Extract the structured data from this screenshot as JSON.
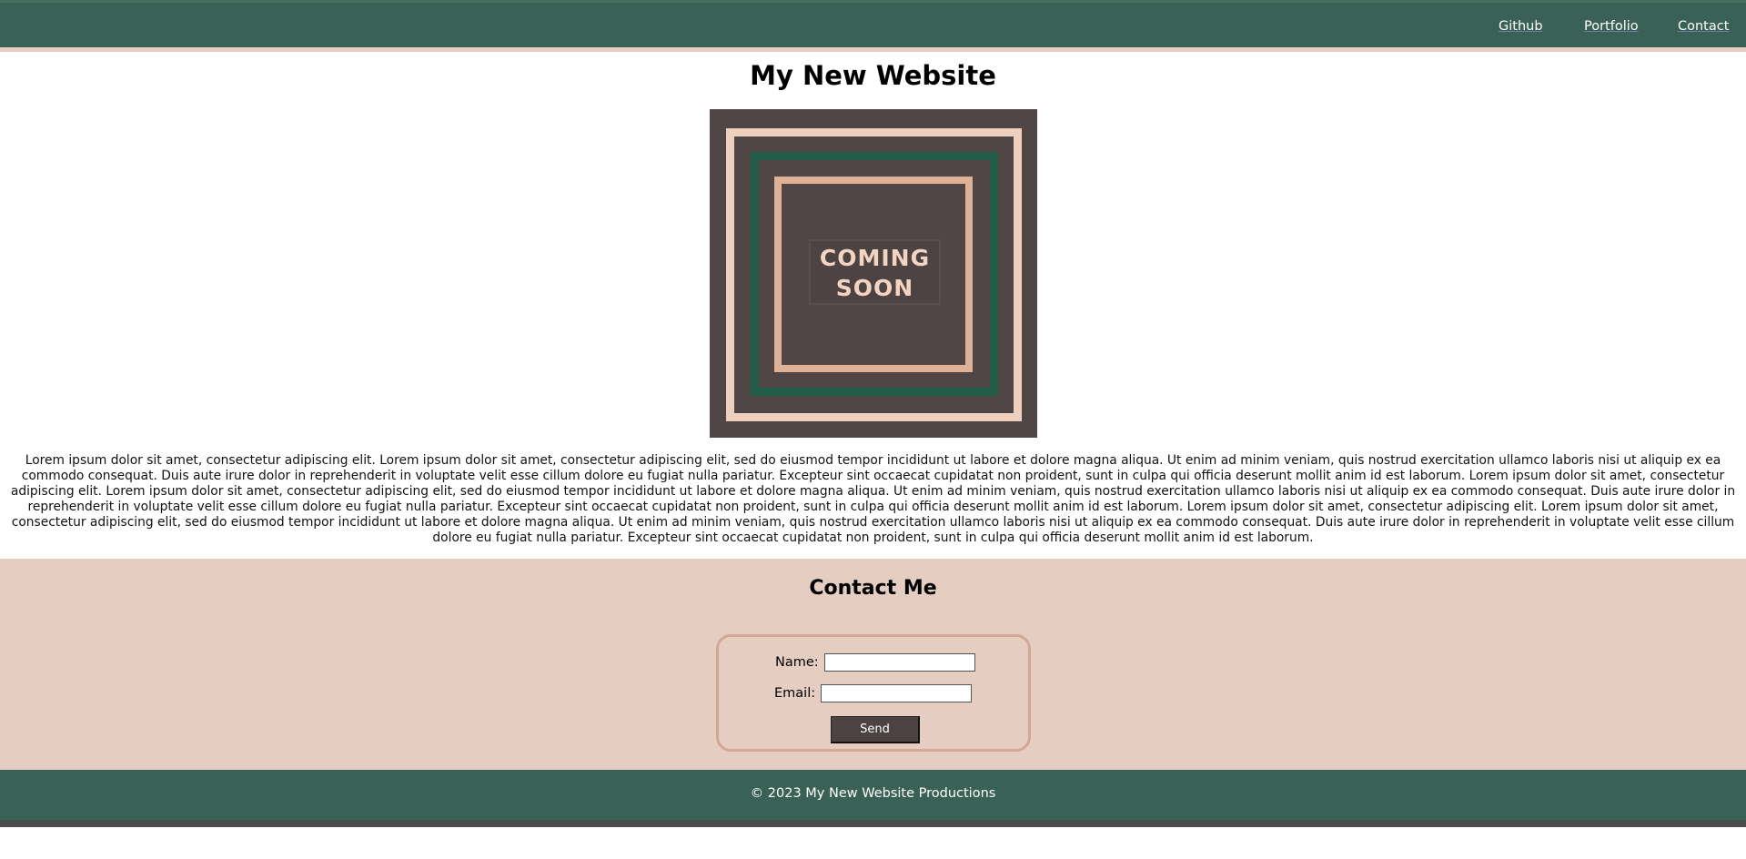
{
  "nav": {
    "links": [
      "Github",
      "Portfolio",
      "Contact"
    ]
  },
  "header": {
    "title": "My New Website"
  },
  "hero": {
    "image_text": "COMING SOON",
    "colors": {
      "background": "#504645",
      "outer_square": "#efcfbe",
      "middle_square": "#215c48",
      "inner_square": "#dfb195"
    }
  },
  "intro": {
    "text": "Lorem ipsum dolor sit amet, consectetur adipiscing elit. Lorem ipsum dolor sit amet, consectetur adipiscing elit, sed do eiusmod tempor incididunt ut labore et dolore magna aliqua. Ut enim ad minim veniam, quis nostrud exercitation ullamco laboris nisi ut aliquip ex ea commodo consequat. Duis aute irure dolor in reprehenderit in voluptate velit esse cillum dolore eu fugiat nulla pariatur. Excepteur sint occaecat cupidatat non proident, sunt in culpa qui officia deserunt mollit anim id est laborum. Lorem ipsum dolor sit amet, consectetur adipiscing elit. Lorem ipsum dolor sit amet, consectetur adipiscing elit, sed do eiusmod tempor incididunt ut labore et dolore magna aliqua. Ut enim ad minim veniam, quis nostrud exercitation ullamco laboris nisi ut aliquip ex ea commodo consequat. Duis aute irure dolor in reprehenderit in voluptate velit esse cillum dolore eu fugiat nulla pariatur. Excepteur sint occaecat cupidatat non proident, sunt in culpa qui officia deserunt mollit anim id est laborum. Lorem ipsum dolor sit amet, consectetur adipiscing elit. Lorem ipsum dolor sit amet, consectetur adipiscing elit, sed do eiusmod tempor incididunt ut labore et dolore magna aliqua. Ut enim ad minim veniam, quis nostrud exercitation ullamco laboris nisi ut aliquip ex ea commodo consequat. Duis aute irure dolor in reprehenderit in voluptate velit esse cillum dolore eu fugiat nulla pariatur. Excepteur sint occaecat cupidatat non proident, sunt in culpa qui officia deserunt mollit anim id est laborum."
  },
  "contact": {
    "heading": "Contact Me",
    "name_label": "Name:",
    "name_value": "",
    "email_label": "Email:",
    "email_value": "",
    "send_label": "Send"
  },
  "footer": {
    "text": "© 2023 My New Website Productions"
  },
  "theme": {
    "header_green": "#3a6155",
    "contact_bg": "#e5cdc2",
    "button_bg": "#4b4241"
  }
}
